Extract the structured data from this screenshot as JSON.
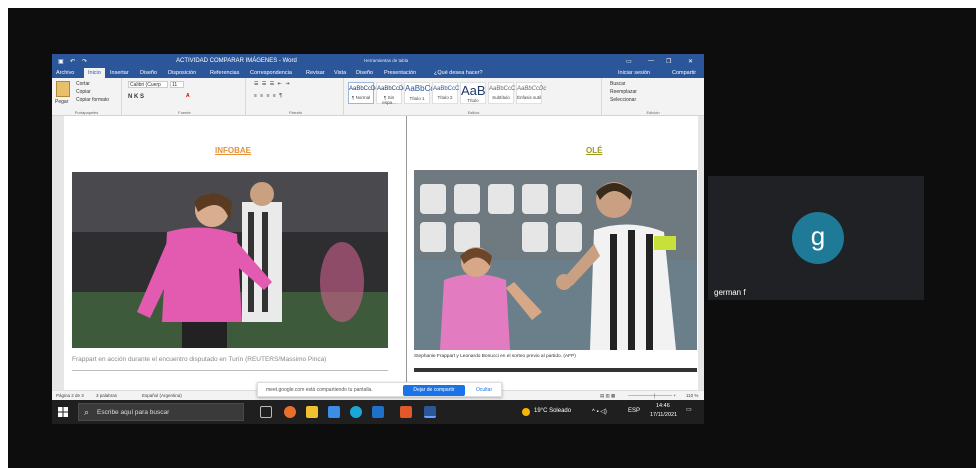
{
  "word": {
    "title": "ACTIVIDAD COMPARAR IMÁGENES - Word",
    "context_tab": "Herramientas de tabla",
    "tell_me": "¿Qué desea hacer?",
    "signin": "Iniciar sesión",
    "share": "Compartir",
    "tabs": [
      "Archivo",
      "Inicio",
      "Insertar",
      "Diseño",
      "Disposición",
      "Referencias",
      "Correspondencia",
      "Revisar",
      "Vista",
      "Diseño",
      "Presentación"
    ],
    "clipboard": {
      "paste": "Pegar",
      "cut": "Cortar",
      "copy": "Copiar",
      "format_painter": "Copiar formato",
      "label": "Portapapeles"
    },
    "font": {
      "name": "Calibri (Cuerp",
      "size": "11",
      "bold_italic": "N K S",
      "label": "Fuente"
    },
    "paragraph_label": "Párrafo",
    "styles": [
      {
        "preview": "AaBbCcDc",
        "name": "¶ Normal"
      },
      {
        "preview": "AaBbCcDc",
        "name": "¶ Sin espa..."
      },
      {
        "preview": "AaBbCc",
        "name": "Título 1"
      },
      {
        "preview": "AaBbCcC",
        "name": "Título 2"
      },
      {
        "preview": "AaB",
        "name": "Título"
      },
      {
        "preview": "AaBbCcC",
        "name": "Subtítulo"
      },
      {
        "preview": "AaBbCcDc",
        "name": "Énfasis sutil"
      }
    ],
    "styles_label": "Estilos",
    "editing": {
      "find": "Buscar",
      "replace": "Reemplazar",
      "select": "Seleccionar",
      "label": "Edición"
    },
    "doc": {
      "heading_a": "INFOBAE",
      "heading_b": "OLÉ",
      "caption_a": "Frappart en acción durante el encuentro disputado en Turín (REUTERS/Massimo Pinca)",
      "caption_b": "Stephanie Frappart y Leonardo Bonucci en el sorteo previo al partido. (AFP)"
    },
    "status": {
      "page": "Página 2 de 3",
      "words": "3 palabras",
      "language": "Español (Argentina)",
      "zoom": "110 %"
    }
  },
  "share_bar": {
    "message": "meet.google.com está compartiendo tu pantalla.",
    "stop_label": "Dejar de compartir",
    "hide_label": "Ocultar"
  },
  "taskbar": {
    "search_placeholder": "Escribe aquí para buscar",
    "weather": "19°C Soleado",
    "lang": "ESP",
    "time": "14:46",
    "date": "17/11/2021"
  },
  "participant": {
    "initial": "g",
    "name": "german f",
    "avatar_color": "#1e7a96"
  }
}
